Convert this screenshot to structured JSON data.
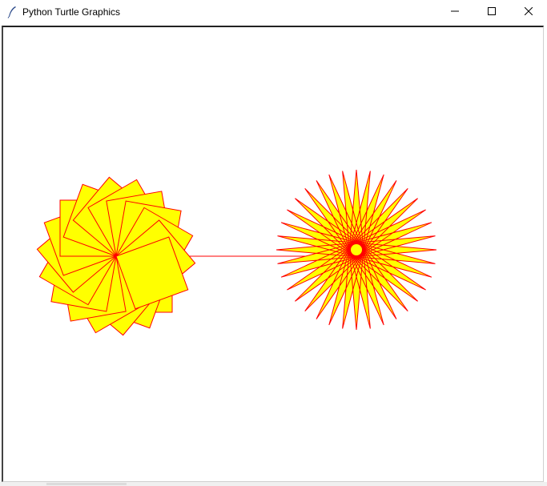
{
  "window": {
    "title": "Python Turtle Graphics",
    "app_icon": "feather-pen-icon",
    "controls": {
      "minimize_icon": "minimize-icon",
      "maximize_icon": "maximize-icon",
      "close_icon": "close-icon"
    }
  },
  "colors": {
    "pen": "#ff0000",
    "fill": "#ffff00",
    "background": "#ffffff"
  },
  "drawing": {
    "left_figure": {
      "shape": "rotated-squares",
      "count": 18
    },
    "right_figure": {
      "shape": "star-burst",
      "points": 36
    },
    "connector": "straight-line"
  }
}
